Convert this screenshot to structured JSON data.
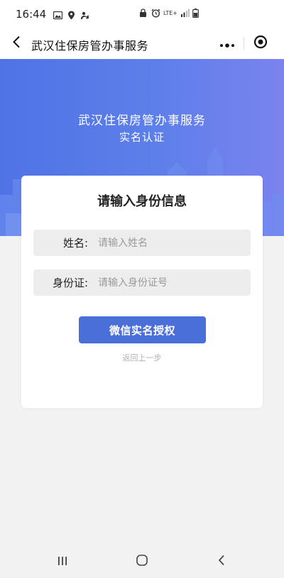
{
  "status_bar": {
    "time": "16:44",
    "network": "LTE+"
  },
  "nav_bar": {
    "title": "武汉住保房管办事服务",
    "back_icon": "chevron-left-icon",
    "more_icon": "more-dots-icon",
    "close_icon": "target-circle-icon"
  },
  "hero": {
    "title": "武汉住保房管办事服务",
    "subtitle": "实名认证",
    "gradient_start": "#4f73e6",
    "gradient_end": "#7b83ef"
  },
  "form": {
    "heading": "请输入身份信息",
    "name_label": "姓名:",
    "name_placeholder": "请输入姓名",
    "name_value": "",
    "id_label": "身份证:",
    "id_placeholder": "请输入身份证号",
    "id_value": "",
    "submit_label": "微信实名授权",
    "back_link": "返回上一步",
    "accent_color": "#4a6fd9"
  },
  "system_nav": {
    "recents_icon": "recents-icon",
    "home_icon": "home-icon",
    "back_icon": "back-icon"
  }
}
